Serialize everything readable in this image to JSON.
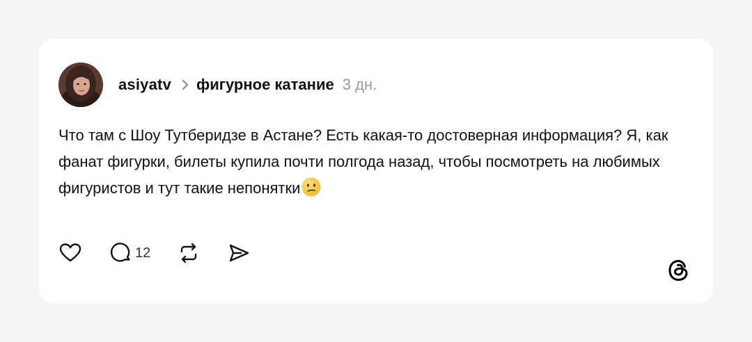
{
  "post": {
    "username": "asiyatv",
    "topic": "фигурное катание",
    "time": "3 дн.",
    "text": "Что там с Шоу Тутберидзе в Астане? Есть какая-то достоверная информация? Я, как фанат фигурки, билеты купила почти полгода назад, чтобы посмотреть на любимых фигуристов и тут такие непонятки",
    "emoji": "confused-face-emoji"
  },
  "actions": {
    "like_icon": "heart-icon",
    "reply_icon": "comment-icon",
    "reply_count": "12",
    "repost_icon": "repost-icon",
    "share_icon": "send-icon"
  },
  "branding": {
    "logo": "threads-logo-icon"
  },
  "colors": {
    "background": "#f5f5f5",
    "card": "#ffffff",
    "text": "#111111",
    "muted": "#9a9a9a"
  }
}
